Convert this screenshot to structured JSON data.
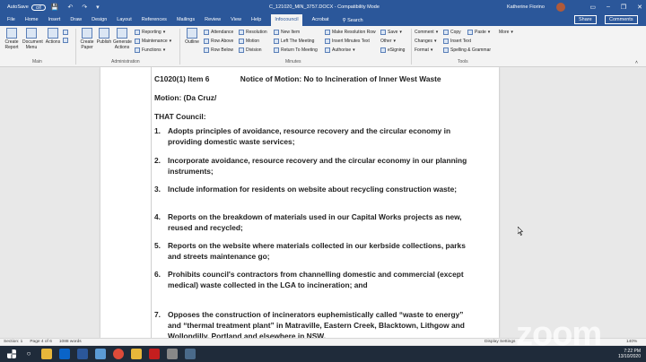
{
  "titlebar": {
    "autosave": "AutoSave",
    "autosave_state": "Off",
    "doc_title": "C_121020_MIN_3757.DOCX - Compatibility Mode",
    "user": "Katherine Fiorino"
  },
  "tabs": [
    "File",
    "Home",
    "Insert",
    "Draw",
    "Design",
    "Layout",
    "References",
    "Mailings",
    "Review",
    "View",
    "Help",
    "Infocouncil",
    "Acrobat"
  ],
  "active_tab": "Infocouncil",
  "search_label": "Search",
  "share_label": "Share",
  "comments_label": "Comments",
  "ribbon": {
    "main": {
      "create_report": "Create Report",
      "document_menu": "Document Menu",
      "actions": "Actions",
      "label": "Main"
    },
    "admin": {
      "create_paper": "Create Paper",
      "publish": "Publish",
      "generate_actions": "Generate Actions",
      "reporting": "Reporting",
      "maintenance": "Maintenance",
      "functions": "Functions",
      "label": "Administration"
    },
    "minutes": {
      "outline": "Outline",
      "attendance": "Attendance",
      "row_above": "Row Above",
      "row_below": "Row Below",
      "resolution": "Resolution",
      "motion": "Motion",
      "division": "Division",
      "new_item": "New Item",
      "left_the_meeting": "Left The Meeting",
      "return_to_meeting": "Return To Meeting",
      "make_resolution_row": "Make Resolution Row",
      "insert_minutes_text": "Insert Minutes Text",
      "authorise": "Authorise",
      "save": "Save",
      "other": "Other",
      "esigning": "eSigning",
      "label": "Minutes"
    },
    "tools": {
      "comment": "Comment",
      "changes": "Changes",
      "format": "Format",
      "copy": "Copy",
      "insert_text": "Insert Text",
      "spelling": "Spelling & Grammar",
      "paste": "Paste",
      "more": "More",
      "label": "Tools"
    }
  },
  "document": {
    "header_item": "C1020(1) Item 6",
    "header_title": "Notice of Motion: No to Incineration of Inner West Waste",
    "motion": "Motion: (Da Cruz/",
    "council": "THAT Council:",
    "items": [
      {
        "num": "1.",
        "text": "Adopts principles of avoidance, resource recovery and the circular economy in providing domestic waste services;"
      },
      {
        "num": "2.",
        "text": "Incorporate avoidance, resource recovery and the circular economy in our planning instruments;"
      },
      {
        "num": "3.",
        "text": "Include information for residents on website about recycling construction waste;"
      },
      {
        "num": "4.",
        "text": "Reports on the breakdown of materials used in our Capital Works projects as new, reused and recycled;"
      },
      {
        "num": "5.",
        "text": "Reports on the website where materials collected in our kerbside collections, parks and streets maintenance go;"
      },
      {
        "num": "6.",
        "text": "Prohibits council's contractors from channelling domestic and commercial (except medical) waste collected in the LGA to incineration; and"
      },
      {
        "num": "7.",
        "text": "Opposes the construction of incinerators euphemistically called “waste to energy” and “thermal treatment plant” in Matraville, Eastern Creek, Blacktown, Lithgow and Wollondilly, Portland and elsewhere in NSW."
      }
    ]
  },
  "statusbar": {
    "section": "Section: 1",
    "page": "Page 4 of 6",
    "words": "1088 words",
    "display": "Display Settings",
    "zoom": "140%"
  },
  "watermark": "zoom",
  "tray": {
    "time": "7:22 PM",
    "date": "13/10/2020"
  }
}
